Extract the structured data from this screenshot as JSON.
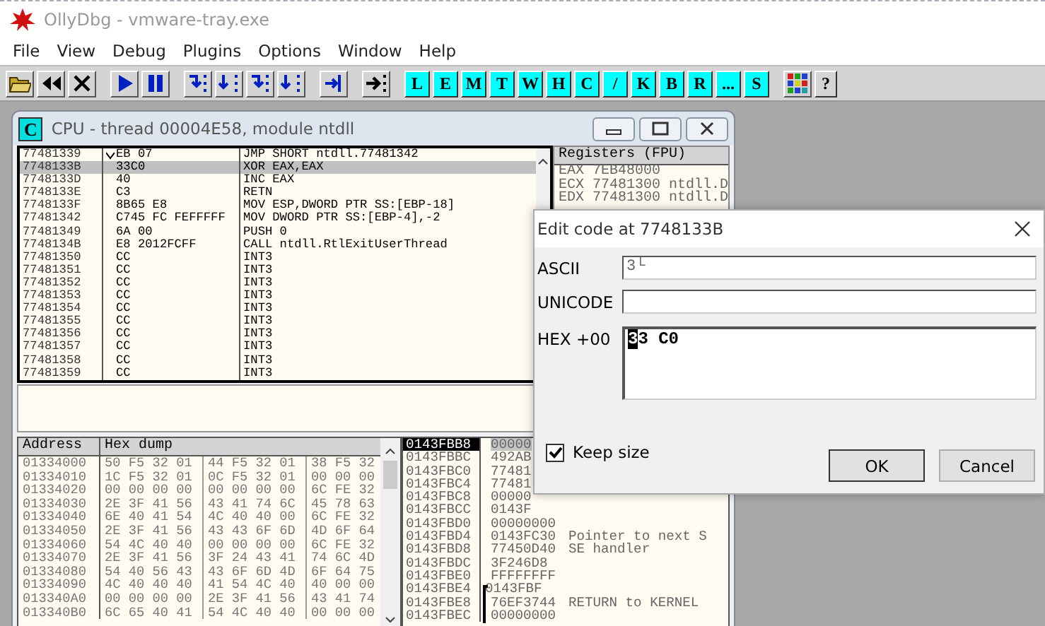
{
  "app_window": {
    "title": "OllyDbg - vmware-tray.exe"
  },
  "menu": [
    "File",
    "View",
    "Debug",
    "Plugins",
    "Options",
    "Window",
    "Help"
  ],
  "window_buttons": [
    "L",
    "E",
    "M",
    "T",
    "W",
    "H",
    "C",
    "/",
    "K",
    "B",
    "R",
    "...",
    "S"
  ],
  "help_button": "?",
  "cpu_window": {
    "icon_letter": "C",
    "title": "CPU - thread 00004E58, module ntdll",
    "disassembly": [
      {
        "address": "77481339",
        "jump": true,
        "hex": "EB 07",
        "instruction": "JMP SHORT ntdll.77481342",
        "selected": false
      },
      {
        "address": "7748133B",
        "jump": false,
        "hex": "33C0",
        "instruction": "XOR EAX,EAX",
        "selected": true
      },
      {
        "address": "7748133D",
        "jump": false,
        "hex": "40",
        "instruction": "INC EAX",
        "selected": false
      },
      {
        "address": "7748133E",
        "jump": false,
        "hex": "C3",
        "instruction": "RETN",
        "selected": false
      },
      {
        "address": "7748133F",
        "jump": false,
        "hex": "8B65 E8",
        "instruction": "MOV ESP,DWORD PTR SS:[EBP-18]",
        "selected": false
      },
      {
        "address": "77481342",
        "jump": false,
        "hex": "C745 FC FEFFFFF",
        "instruction": "MOV DWORD PTR SS:[EBP-4],-2",
        "selected": false
      },
      {
        "address": "77481349",
        "jump": false,
        "hex": "6A 00",
        "instruction": "PUSH 0",
        "selected": false
      },
      {
        "address": "7748134B",
        "jump": false,
        "hex": "E8 2012FCFF",
        "instruction": "CALL ntdll.RtlExitUserThread",
        "selected": false
      },
      {
        "address": "77481350",
        "jump": false,
        "hex": "CC",
        "instruction": "INT3",
        "selected": false
      },
      {
        "address": "77481351",
        "jump": false,
        "hex": "CC",
        "instruction": "INT3",
        "selected": false
      },
      {
        "address": "77481352",
        "jump": false,
        "hex": "CC",
        "instruction": "INT3",
        "selected": false
      },
      {
        "address": "77481353",
        "jump": false,
        "hex": "CC",
        "instruction": "INT3",
        "selected": false
      },
      {
        "address": "77481354",
        "jump": false,
        "hex": "CC",
        "instruction": "INT3",
        "selected": false
      },
      {
        "address": "77481355",
        "jump": false,
        "hex": "CC",
        "instruction": "INT3",
        "selected": false
      },
      {
        "address": "77481356",
        "jump": false,
        "hex": "CC",
        "instruction": "INT3",
        "selected": false
      },
      {
        "address": "77481357",
        "jump": false,
        "hex": "CC",
        "instruction": "INT3",
        "selected": false
      },
      {
        "address": "77481358",
        "jump": false,
        "hex": "CC",
        "instruction": "INT3",
        "selected": false
      },
      {
        "address": "77481359",
        "jump": false,
        "hex": "CC",
        "instruction": "INT3",
        "selected": false
      }
    ],
    "registers": {
      "title": "Registers (FPU)",
      "lines": [
        "EAX 7EB48000",
        "ECX 77481300 ntdll.D",
        "EDX 77481300 ntdll.D"
      ]
    },
    "hex_dump": {
      "columns": [
        "Address",
        "Hex dump"
      ],
      "rows": [
        {
          "address": "01334000",
          "bytes": [
            "50 F5 32 01",
            "44 F5 32 01",
            "38 F5 32"
          ]
        },
        {
          "address": "01334010",
          "bytes": [
            "1C F5 32 01",
            "0C F5 32 01",
            "00 00 00"
          ]
        },
        {
          "address": "01334020",
          "bytes": [
            "00 00 00 00",
            "00 00 00 00",
            "6C FE 32"
          ]
        },
        {
          "address": "01334030",
          "bytes": [
            "2E 3F 41 56",
            "43 41 74 6C",
            "45 78 63"
          ]
        },
        {
          "address": "01334040",
          "bytes": [
            "6E 40 41 54",
            "4C 40 40 00",
            "6C FE 32"
          ]
        },
        {
          "address": "01334050",
          "bytes": [
            "2E 3F 41 56",
            "43 43 6F 6D",
            "4D 6F 64"
          ]
        },
        {
          "address": "01334060",
          "bytes": [
            "54 4C 40 40",
            "00 00 00 00",
            "6C FE 32"
          ]
        },
        {
          "address": "01334070",
          "bytes": [
            "2E 3F 41 56",
            "3F 24 43 41",
            "74 6C 4D"
          ]
        },
        {
          "address": "01334080",
          "bytes": [
            "54 40 56 43",
            "43 6F 6D 4D",
            "6F 64 75"
          ]
        },
        {
          "address": "01334090",
          "bytes": [
            "4C 40 40 40",
            "41 54 4C 40",
            "40 00 00"
          ]
        },
        {
          "address": "013340A0",
          "bytes": [
            "00 00 00 00",
            "2E 3F 41 56",
            "43 41 74"
          ]
        },
        {
          "address": "013340B0",
          "bytes": [
            "6C 65 40 41",
            "54 4C 40 40",
            "00 00 00"
          ]
        }
      ]
    },
    "stack": [
      {
        "address": "0143FBB8",
        "value": "00000",
        "selected": true
      },
      {
        "address": "0143FBBC",
        "value": "492AB",
        "selected": false
      },
      {
        "address": "0143FBC0",
        "value": "77481",
        "selected": false
      },
      {
        "address": "0143FBC4",
        "value": "77481",
        "selected": false
      },
      {
        "address": "0143FBC8",
        "value": "00000",
        "selected": false
      },
      {
        "address": "0143FBCC",
        "value": "0143F",
        "selected": false
      },
      {
        "address": "0143FBD0",
        "value": "00000000",
        "selected": false
      },
      {
        "address": "0143FBD4",
        "value": "0143FC30",
        "comment": "Pointer to next S",
        "selected": false
      },
      {
        "address": "0143FBD8",
        "value": "77450D40",
        "comment": "SE handler",
        "selected": false
      },
      {
        "address": "0143FBDC",
        "value": "3F246D8",
        "selected": false
      },
      {
        "address": "0143FBE0",
        "value": "FFFFFFFF",
        "selected": false
      },
      {
        "address": "0143FBE4",
        "value": "0143FBF",
        "selected": false
      },
      {
        "address": "0143FBE8",
        "value": "76EF3744",
        "comment": "RETURN to KERNEL",
        "selected": false
      },
      {
        "address": "0143FBEC",
        "value": "00000000",
        "selected": false
      }
    ]
  },
  "dialog": {
    "title": "Edit code at 7748133B",
    "fields": [
      {
        "label": "ASCII",
        "value": "3└",
        "kind": "line"
      },
      {
        "label": "UNICODE",
        "kind": "line"
      },
      {
        "label": "HEX +00",
        "value": "33 C0",
        "kind": "hex",
        "caret_at_start": true
      }
    ],
    "keep_size": {
      "label": "Keep size",
      "checked": true
    },
    "buttons": [
      "OK",
      "Cancel"
    ]
  }
}
